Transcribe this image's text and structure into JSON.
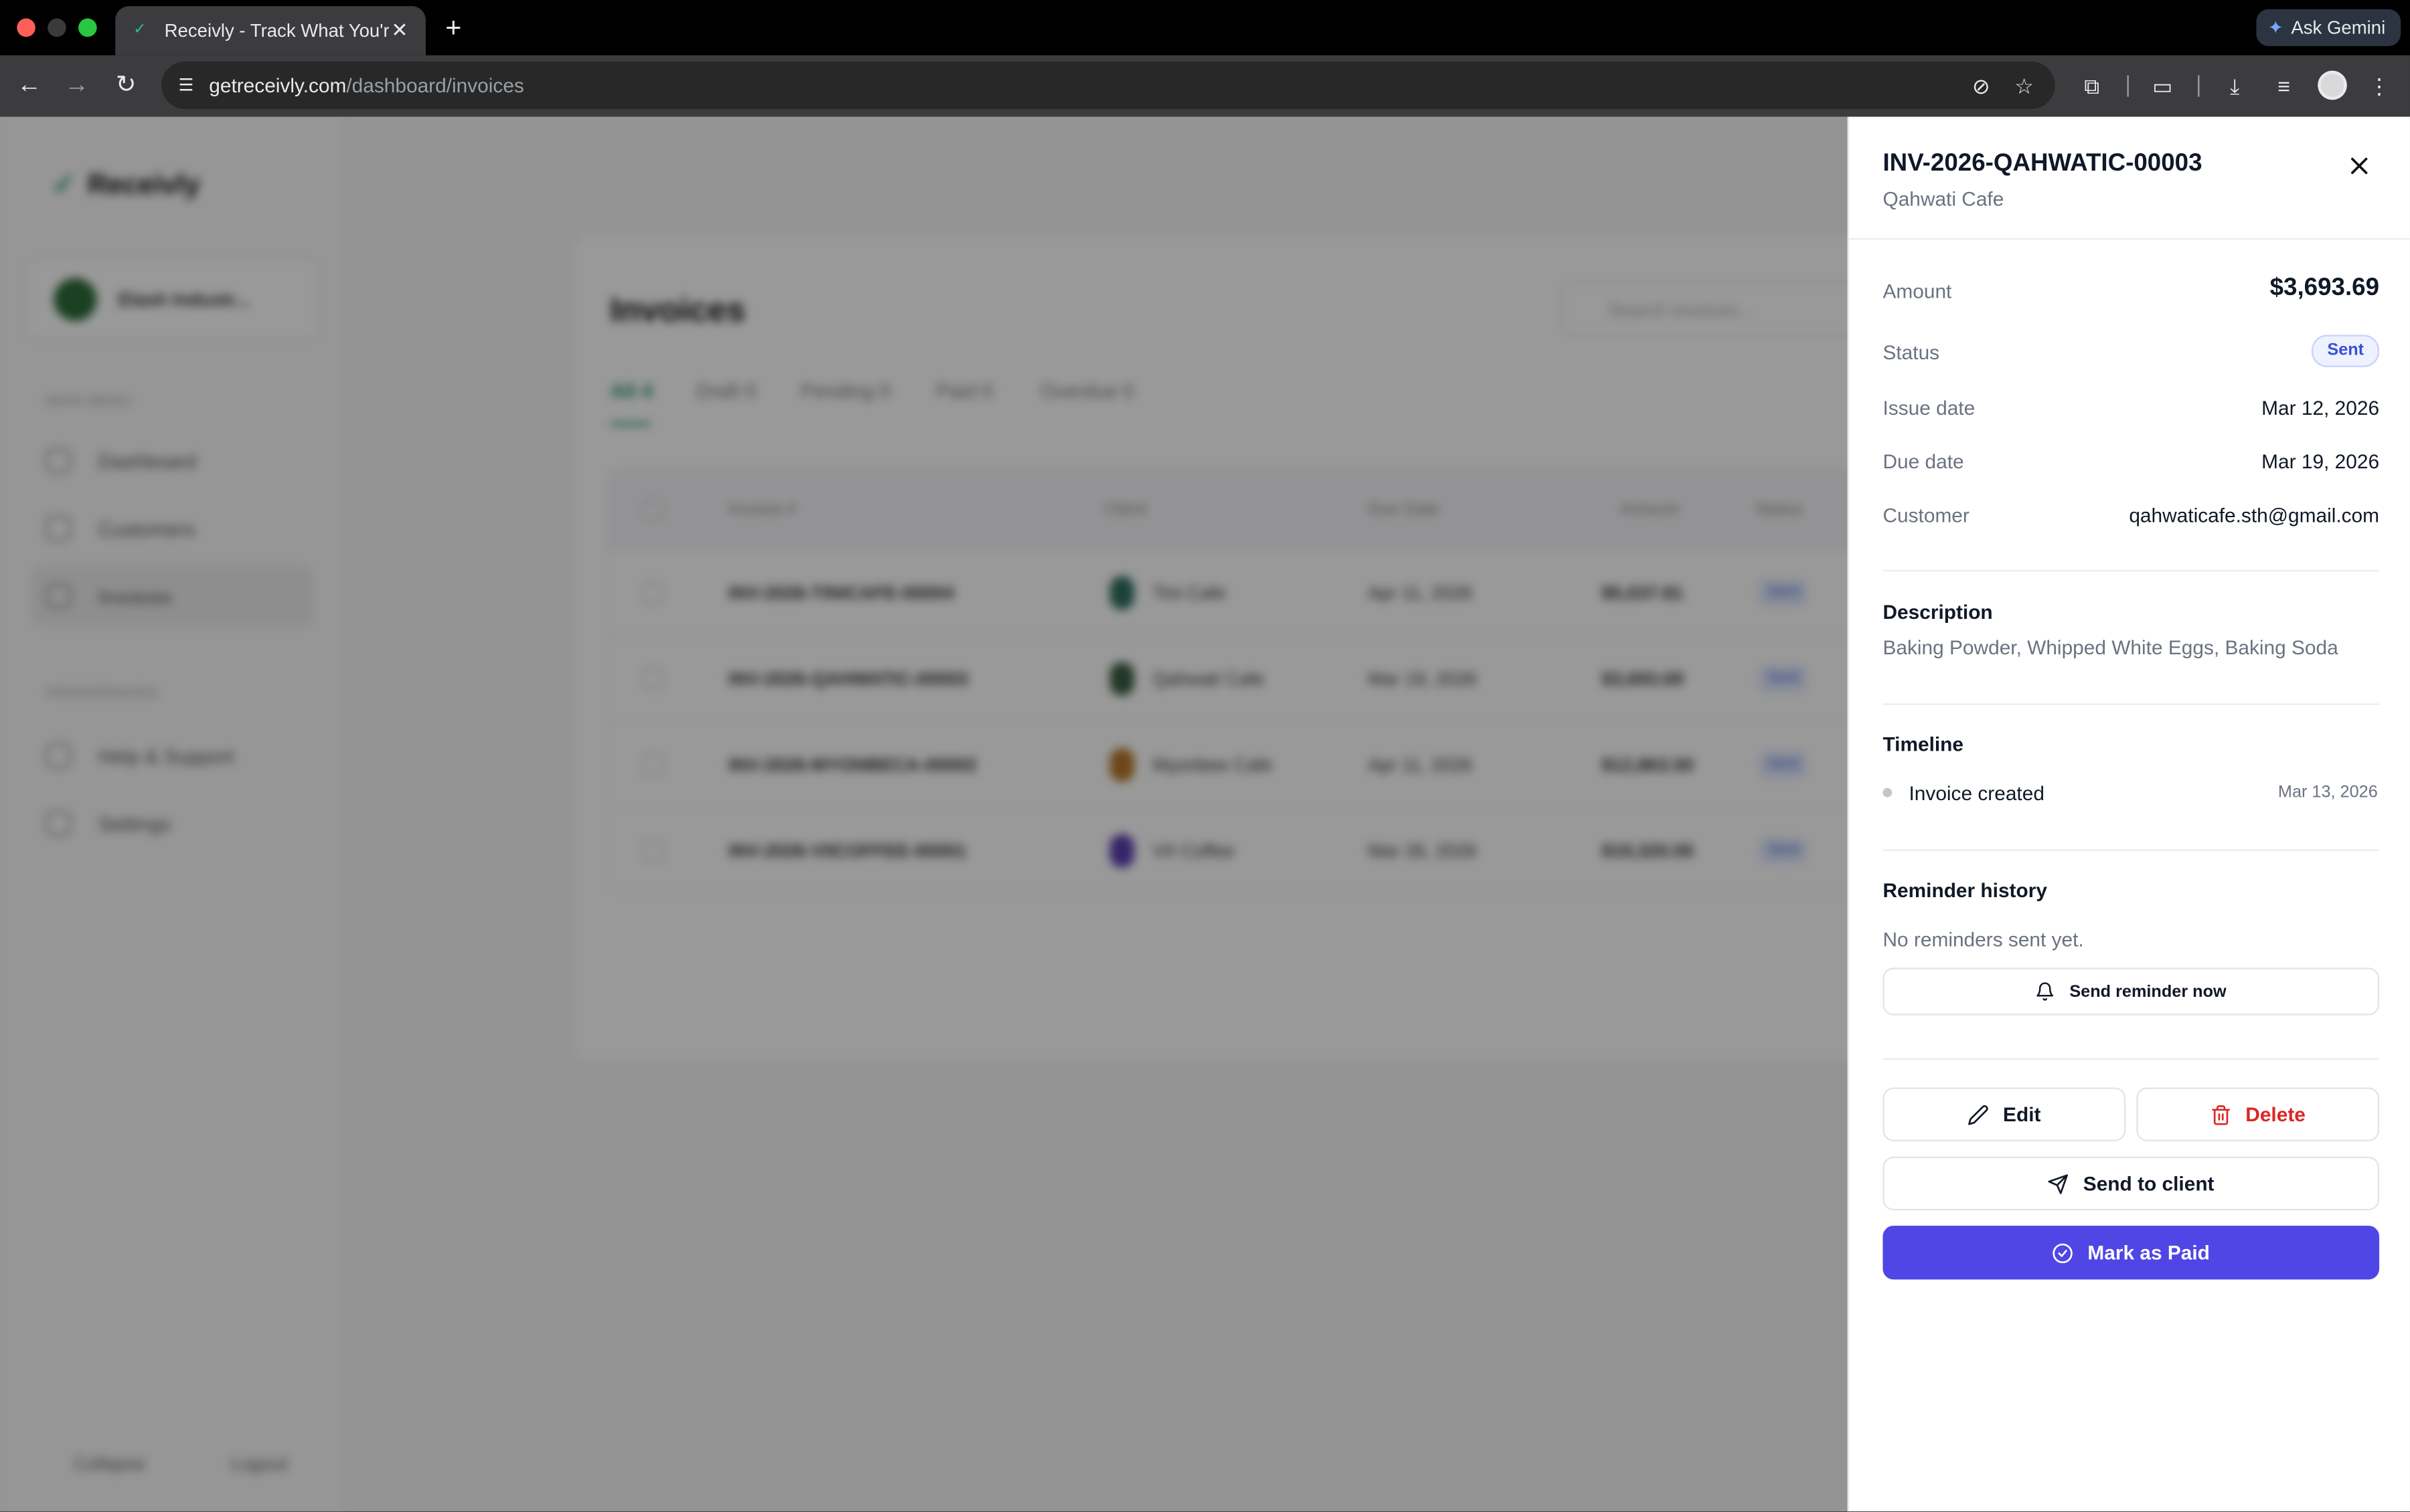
{
  "browser": {
    "tab_title": "Receivly - Track What You're",
    "url_host": "getreceivly.com",
    "url_path": "/dashboard/invoices",
    "gemini_label": "Ask Gemini"
  },
  "background_app": {
    "logo": "Receivly",
    "workspace_name": "Elash Industr...",
    "section_main": "MAIN MENU",
    "nav": [
      "Dashboard",
      "Customers",
      "Invoices"
    ],
    "section_pref": "PREFERENCES",
    "nav_pref": [
      "Help & Support",
      "Settings"
    ],
    "footer_collapse": "Collapse",
    "footer_logout": "Logout",
    "page_title": "Invoices",
    "search_placeholder": "Search invoices...",
    "tabs": [
      "All 4",
      "Draft 0",
      "Pending 0",
      "Paid 0",
      "Overdue 0"
    ],
    "columns": [
      "Invoice #",
      "Client",
      "Due Date",
      "Amount",
      "Status"
    ],
    "rows": [
      {
        "invoice": "INV-2026-TINICAFE-00004",
        "client": "Tini Cafe",
        "due": "Apr 11, 2026",
        "amount": "$5,037.81",
        "status": "Sent"
      },
      {
        "invoice": "INV-2026-QAHWATIC-00003",
        "client": "Qahwati Cafe",
        "due": "Mar 19, 2026",
        "amount": "$3,693.69",
        "status": "Sent"
      },
      {
        "invoice": "INV-2026-MYONBECA-00002",
        "client": "Myonbee Cafe",
        "due": "Apr 11, 2026",
        "amount": "$12,863.50",
        "status": "Sent"
      },
      {
        "invoice": "INV-2026-VIICOFFEE-00001",
        "client": "VII Coffee",
        "due": "Mar 26, 2026",
        "amount": "$19,320.00",
        "status": "Sent"
      }
    ]
  },
  "drawer": {
    "title": "INV-2026-QAHWATIC-00003",
    "subtitle": "Qahwati Cafe",
    "amount_label": "Amount",
    "amount_value": "$3,693.69",
    "status_label": "Status",
    "status_value": "Sent",
    "issue_label": "Issue date",
    "issue_value": "Mar 12, 2026",
    "due_label": "Due date",
    "due_value": "Mar 19, 2026",
    "customer_label": "Customer",
    "customer_value": "qahwaticafe.sth@gmail.com",
    "description_title": "Description",
    "description_text": "Baking Powder, Whipped White Eggs, Baking Soda",
    "timeline_title": "Timeline",
    "timeline_event": "Invoice created",
    "timeline_date": "Mar 13, 2026",
    "reminder_title": "Reminder history",
    "reminder_empty": "No reminders sent yet.",
    "send_reminder_label": "Send reminder now",
    "edit_label": "Edit",
    "delete_label": "Delete",
    "send_client_label": "Send to client",
    "mark_paid_label": "Mark as Paid"
  },
  "colors": {
    "primary": "#4f46e5",
    "danger": "#dc2626",
    "status_sent_bg": "#eef2ff",
    "status_sent_text": "#3b4fd8"
  }
}
